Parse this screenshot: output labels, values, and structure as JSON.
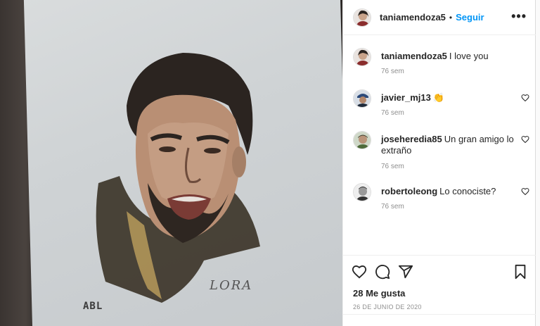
{
  "post": {
    "author": "taniamendoza5",
    "follow_dot": "•",
    "follow_label": "Seguir",
    "more_label": "•••"
  },
  "media": {
    "signature_left": "ABL",
    "signature_right": "LORA"
  },
  "comments": [
    {
      "user": "taniamendoza5",
      "text": "I love you",
      "time": "76 sem",
      "avatar": "woman-portrait"
    },
    {
      "user": "javier_mj13",
      "text": "👏",
      "time": "76 sem",
      "avatar": "man-blue-cap"
    },
    {
      "user": "joseheredia85",
      "text": "Un gran amigo lo extraño",
      "time": "76 sem",
      "avatar": "man-green"
    },
    {
      "user": "robertoleong",
      "text": "Lo conociste?",
      "time": "76 sem",
      "avatar": "man-bw"
    }
  ],
  "footer": {
    "likes": "28 Me gusta",
    "date": "26 DE JUNIO DE 2020"
  },
  "icons": {
    "like": "heart-icon",
    "comment": "comment-icon",
    "share": "share-icon",
    "save": "bookmark-icon",
    "comment_like": "heart-icon"
  },
  "colors": {
    "accent": "#0095f6",
    "muted": "#8e8e8e",
    "text": "#262626"
  }
}
